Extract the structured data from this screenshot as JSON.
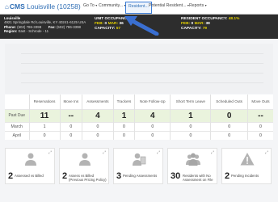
{
  "nav": {
    "brand": "CMS",
    "location": "Louisville (10258)",
    "items": [
      {
        "label": "Go To",
        "caret": "▾"
      },
      {
        "label": "Community...",
        "caret": "▾"
      },
      {
        "label": "Resident...",
        "caret": ""
      },
      {
        "label": "Potential Resident...",
        "caret": "▾"
      },
      {
        "label": "Reports",
        "caret": "▾"
      }
    ]
  },
  "facility": {
    "name": "Louisville",
    "address": "4921 Springdale Rd Louisville, KY 40241-6125 USA",
    "phone_label": "Phone:",
    "phone": "(502) 786-3398",
    "fax_label": "Fax:",
    "fax": "(502) 786-3398",
    "region_label": "Region:",
    "region": "East - Schrode - 11"
  },
  "unit_occupancy": {
    "title": "UNIT OCCUPANC",
    "feb_label": "FEB:",
    "feb_value": "0",
    "mar_label": "MAR:",
    "mar_value": "36",
    "capacity_label": "CAPACITY:",
    "capacity_value": "57"
  },
  "resident_occupancy": {
    "title": "RESIDENT OCCUPANCY:",
    "title_value": "48.1%",
    "feb_label": "FEB:",
    "feb_value": "0",
    "mar_label": "MAR:",
    "mar_value": "38",
    "capacity_label": "CAPACITY:",
    "capacity_value": "79"
  },
  "table": {
    "columns": [
      "Reservations",
      "Move Ins",
      "Assessments",
      "Trackers",
      "Note Follow-Up",
      "Short Term Leave",
      "Scheduled Outs",
      "Move Outs"
    ],
    "rows": [
      {
        "label": "Past Due",
        "values": [
          "11",
          "--",
          "4",
          "1",
          "4",
          "1",
          "0",
          "--"
        ]
      },
      {
        "label": "March",
        "values": [
          "1",
          "0",
          "0",
          "0",
          "0",
          "0",
          "0",
          "0"
        ]
      },
      {
        "label": "April",
        "values": [
          "0",
          "0",
          "0",
          "0",
          "0",
          "0",
          "0",
          "0"
        ]
      }
    ]
  },
  "cards": [
    {
      "num": "2",
      "label": "Assessed vs Billed",
      "icon": "person-icon"
    },
    {
      "num": "2",
      "label": "Assess vs Billed (Previous Pricing Policy)",
      "icon": "person-icon"
    },
    {
      "num": "3",
      "label": "Pending Assessments",
      "icon": "person-clipboard-icon"
    },
    {
      "num": "30",
      "label": "Residents with No Assessment on File",
      "icon": "group-icon"
    },
    {
      "num": "2",
      "label": "Pending Incidents",
      "icon": "warning-icon"
    }
  ],
  "colors": {
    "accent": "#2f6eb5",
    "banner": "#2d2d2d",
    "highlight": "#e6d200",
    "arrow": "#3a6fd1"
  }
}
